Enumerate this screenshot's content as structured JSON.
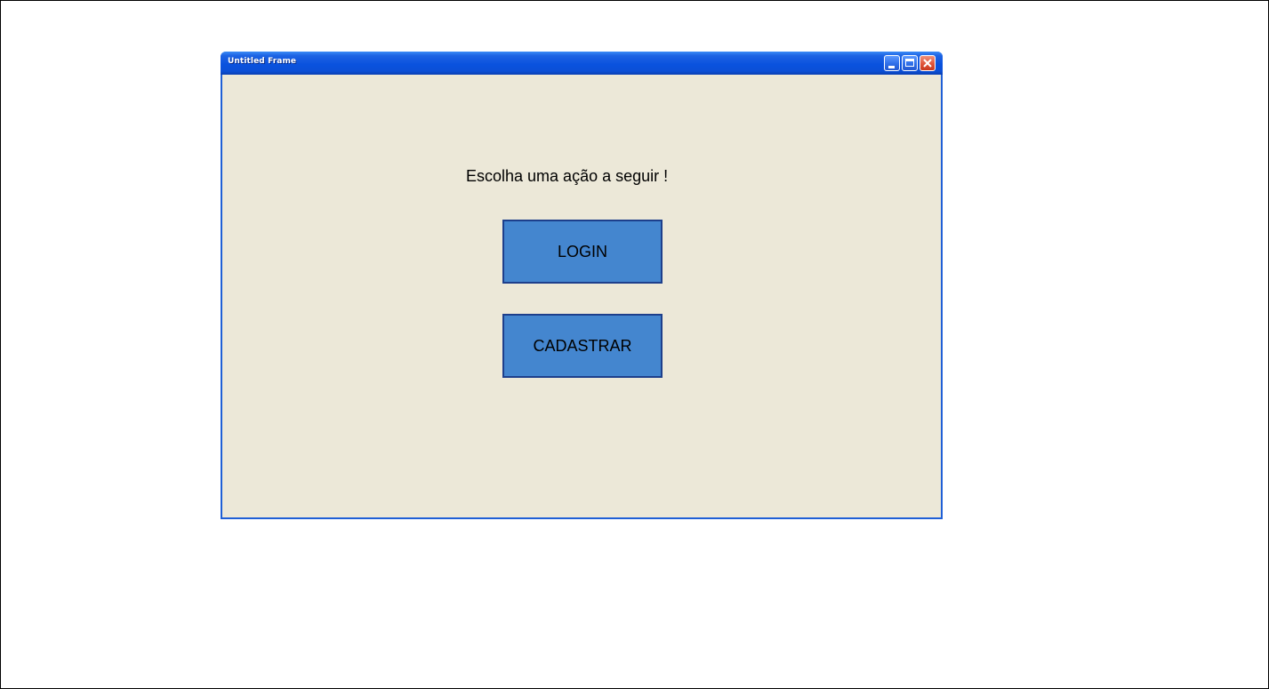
{
  "window": {
    "title": "Untitled Frame",
    "controls": {
      "minimize_icon": "minimize-icon",
      "maximize_icon": "maximize-icon",
      "close_icon": "close-icon"
    }
  },
  "main": {
    "prompt": "Escolha uma ação a seguir !",
    "buttons": [
      {
        "label": "LOGIN"
      },
      {
        "label": "CADASTRAR"
      }
    ]
  },
  "colors": {
    "titlebar_blue": "#0a52de",
    "window_border": "#1f5fd6",
    "window_background": "#ece8d8",
    "button_fill": "#4486cf",
    "button_border": "#1d3f8c",
    "close_button": "#e0553a"
  }
}
